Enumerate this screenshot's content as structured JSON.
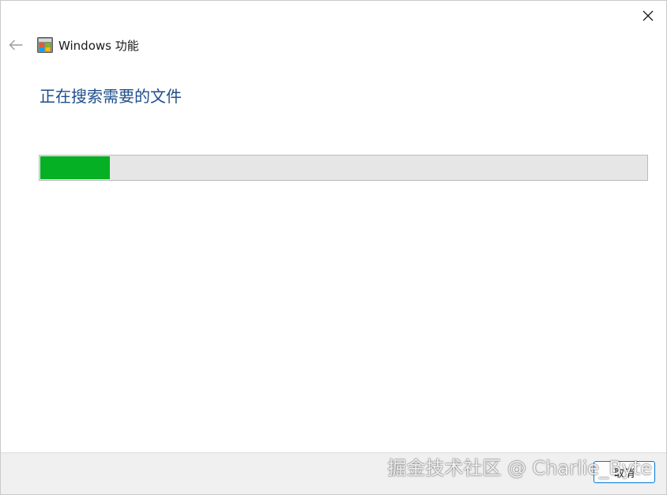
{
  "window": {
    "title": "Windows 功能",
    "close_icon": "close-icon",
    "back_icon": "back-arrow-icon",
    "app_icon": "windows-features-icon"
  },
  "main": {
    "heading": "正在搜索需要的文件",
    "progress": {
      "value_percent": 11.5,
      "fill_color": "#06b025",
      "track_color": "#e6e6e6"
    }
  },
  "footer": {
    "cancel_label": "取消"
  },
  "watermark": {
    "text": "掘金技术社区 @ Charlie_Byte"
  },
  "colors": {
    "heading": "#1e4e8c",
    "accent": "#0078d4"
  }
}
